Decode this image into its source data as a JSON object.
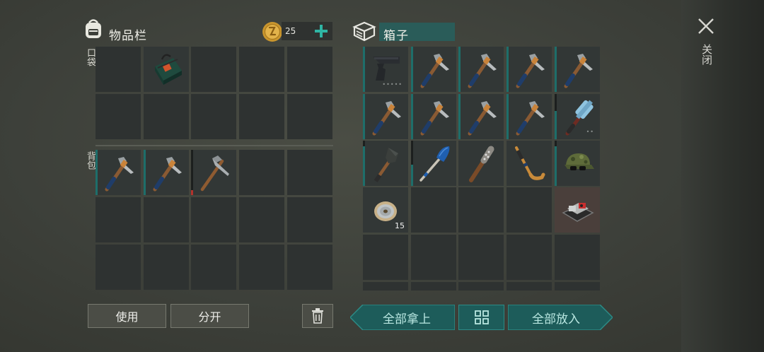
{
  "inventory": {
    "title": "物品栏",
    "pocket_label": "口袋",
    "backpack_label": "背包",
    "coins": "25",
    "use_button": "使用",
    "split_button": "分开"
  },
  "box": {
    "title": "箱子",
    "take_all_button": "全部拿上",
    "put_all_button": "全部放入",
    "items": [
      {
        "name": "pistol-item",
        "dots": "•••••"
      },
      {
        "name": "pickaxe-item"
      },
      {
        "name": "pickaxe-item"
      },
      {
        "name": "pickaxe-item"
      },
      {
        "name": "pickaxe-item"
      },
      {
        "name": "pickaxe-item"
      },
      {
        "name": "pickaxe-item"
      },
      {
        "name": "pickaxe-item"
      },
      {
        "name": "pickaxe-item"
      },
      {
        "name": "sledgehammer-item",
        "dots": "••"
      },
      {
        "name": "shovel-item"
      },
      {
        "name": "paddle-item"
      },
      {
        "name": "nail-bat-item"
      },
      {
        "name": "hockey-stick-item"
      },
      {
        "name": "camo-cap-item"
      },
      {
        "name": "wire-spool-item",
        "count": "15"
      },
      {
        "name": "generator-item"
      }
    ]
  },
  "close_label": "关闭",
  "colors": {
    "accent_teal": "#1d5c5a",
    "durability_teal": "#1e6e6a",
    "durability_red": "#b3322c"
  }
}
